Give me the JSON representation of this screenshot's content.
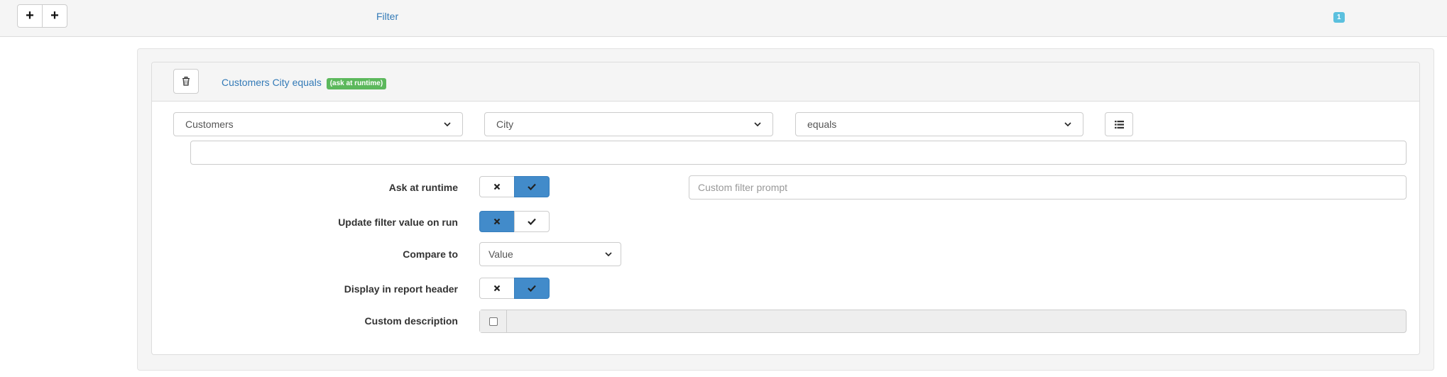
{
  "topbar": {
    "add_button_1": "+",
    "add_button_2": "+",
    "filter_label": "Filter",
    "filter_count": "1"
  },
  "filter": {
    "heading": "Customers City equals",
    "badge": "(ask at runtime)",
    "table_select": "Customers",
    "field_select": "City",
    "operator_select": "equals",
    "value": ""
  },
  "options": {
    "ask_at_runtime": {
      "label": "Ask at runtime",
      "state": "on"
    },
    "prompt_placeholder": "Custom filter prompt",
    "update_on_run": {
      "label": "Update filter value on run",
      "state": "off"
    },
    "compare_to": {
      "label": "Compare to",
      "selected": "Value"
    },
    "display_in_header": {
      "label": "Display in report header",
      "state": "on"
    },
    "custom_description": {
      "label": "Custom description",
      "checked": false,
      "value": ""
    }
  },
  "colors": {
    "link": "#337ab7",
    "active_toggle": "#428bca",
    "badge_success": "#5cb85c",
    "badge_info": "#5bc0de"
  },
  "icons": [
    "plus-icon",
    "trash-icon",
    "list-icon",
    "times-icon",
    "check-icon",
    "chevron-down-icon"
  ]
}
